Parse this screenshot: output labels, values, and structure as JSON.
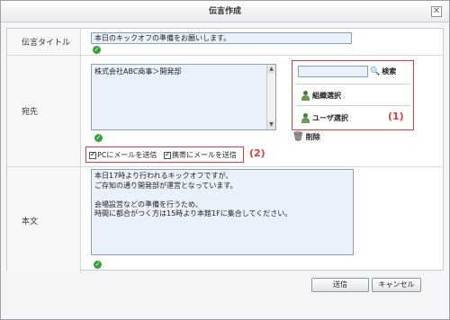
{
  "dialog": {
    "title": "伝言作成"
  },
  "message_title": {
    "label": "伝言タイトル",
    "value": "本日のキックオフの準備をお願いします。"
  },
  "recipient": {
    "label": "宛先",
    "value": "株式会社ABC商事＞開発部",
    "search_label": "検索",
    "org_select_label": "組織選択",
    "user_select_label": "ユーザ選択",
    "delete_label": "削除",
    "send_pc_label": "PCにメールを送信",
    "send_mobile_label": "携帯にメールを送信"
  },
  "body_field": {
    "label": "本文",
    "lines": [
      "本日17時より行われるキックオフですが、",
      "ご存知の通り開発部が運営となっています。",
      "",
      "会場設営などの準備を行うため、",
      "時間に都合がつく方は15時より本館1Fに集合してください。"
    ]
  },
  "annotations": {
    "a1": "(1)",
    "a2": "(2)"
  },
  "footer": {
    "send_label": "送信",
    "cancel_label": "キャンセル"
  },
  "colors": {
    "annotation": "#e23c3c",
    "ok_check": "#37a23b",
    "field_bg": "#eaf1fb"
  }
}
